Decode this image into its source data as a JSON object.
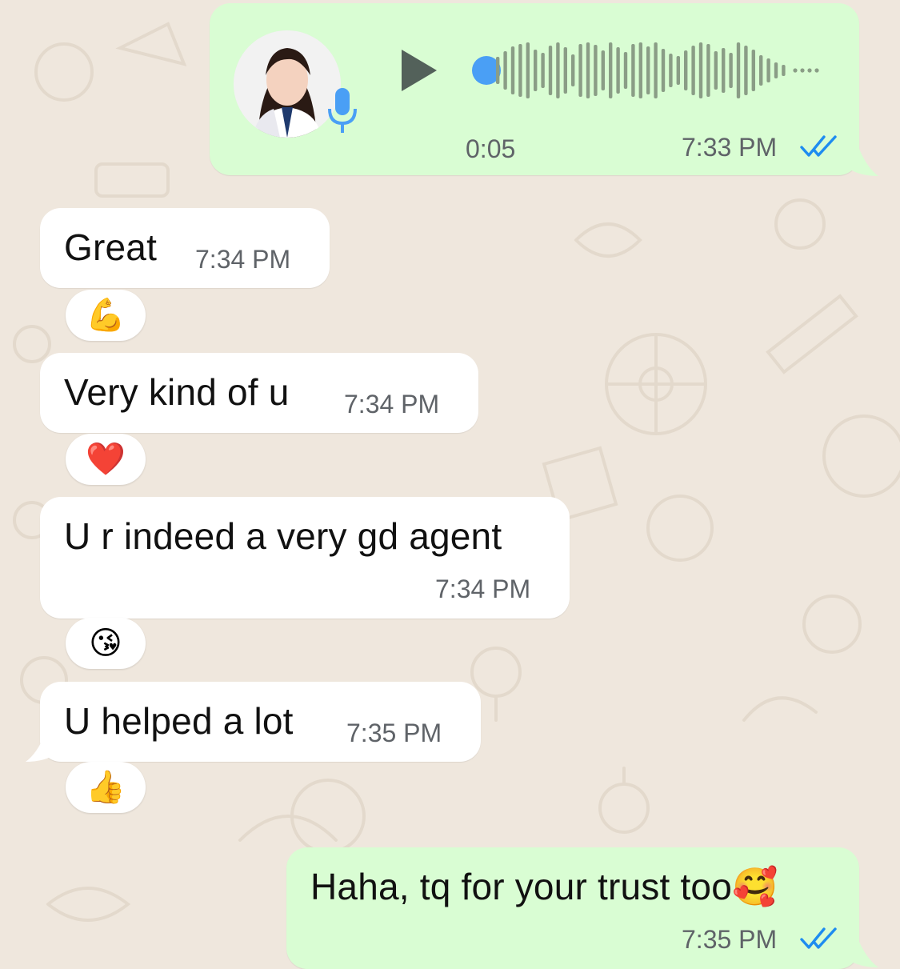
{
  "voice_message": {
    "duration": "0:05",
    "time": "7:33 PM",
    "status_icon": "double-check-read-icon",
    "play_icon": "play-icon",
    "mic_icon": "microphone-icon",
    "progress": 0.0
  },
  "messages": [
    {
      "text": "Great",
      "time": "7:34 PM",
      "reaction": "💪"
    },
    {
      "text": "Very kind of u",
      "time": "7:34 PM",
      "reaction": "❤️"
    },
    {
      "text": "U r indeed a very gd agent",
      "time": "7:34 PM",
      "reaction": "😘"
    },
    {
      "text": "U helped a lot",
      "time": "7:35 PM",
      "reaction": "👍"
    }
  ],
  "reply": {
    "text": "Haha, tq for your trust too🥰",
    "time": "7:35 PM",
    "status_icon": "double-check-read-icon"
  },
  "colors": {
    "wallpaper": "#efe7dd",
    "incoming_bubble": "#ffffff",
    "outgoing_bubble": "#d9fdd3",
    "read_ticks": "#1e8cf0",
    "waveform": "#8a9d86",
    "progress_dot": "#4a9ff5"
  }
}
